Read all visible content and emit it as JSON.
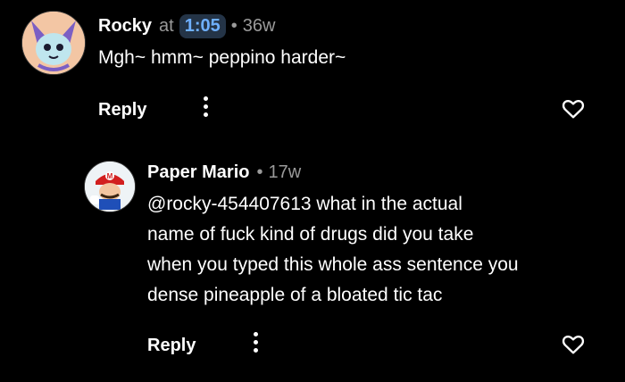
{
  "comment": {
    "author": "Rocky",
    "at_label": "at",
    "timestamp": "1:05",
    "age": "36w",
    "text": "Mgh~ hmm~ peppino harder~",
    "reply_label": "Reply",
    "avatar_icon": "rocky-avatar",
    "colors": {
      "accent_chip_bg": "#243447",
      "accent_chip_text": "#6fb0ff"
    }
  },
  "reply": {
    "author": "Paper Mario",
    "age": "17w",
    "lines": [
      "@rocky-454407613 what in the actual",
      "name of fuck kind of drugs did you take",
      "when you typed this whole ass sentence you",
      "dense pineapple of a bloated tic tac"
    ],
    "reply_label": "Reply",
    "avatar_icon": "paper-mario-avatar"
  },
  "separator": "•",
  "icons": [
    "more-vertical-icon",
    "heart-outline-icon"
  ]
}
